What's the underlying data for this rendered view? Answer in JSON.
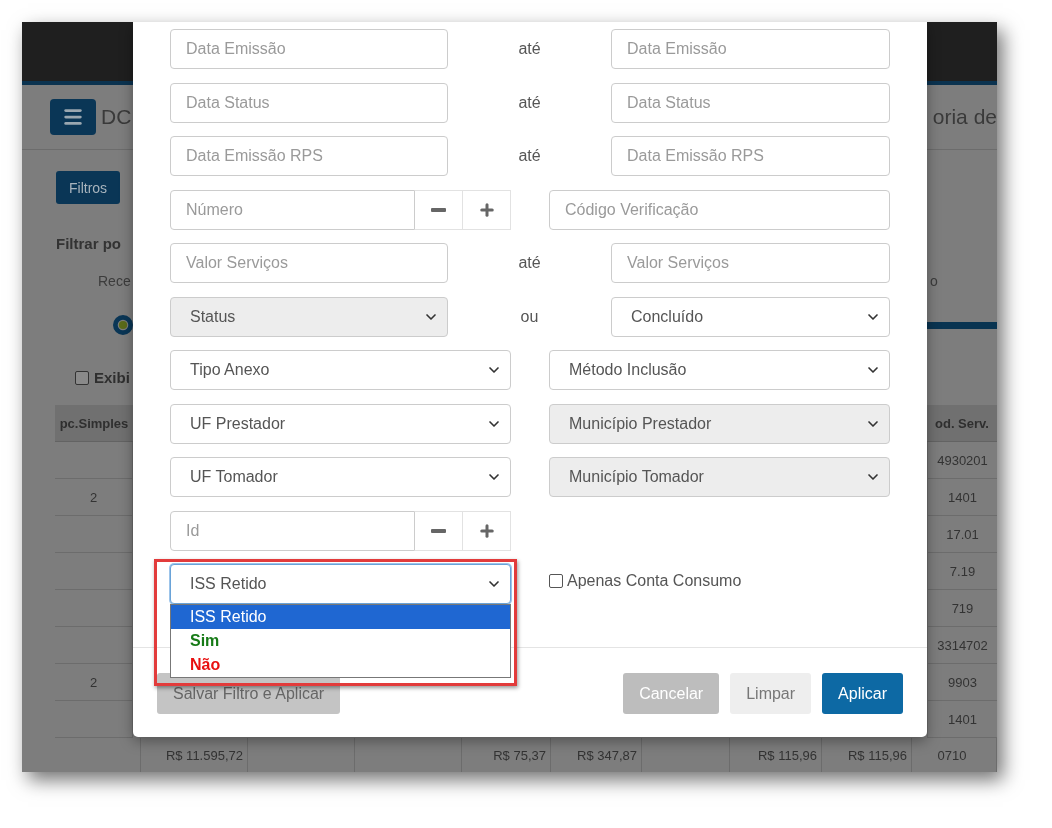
{
  "background": {
    "title": "DC",
    "title_right": "oria de",
    "filter_button": "Filtros",
    "filter_heading": "Filtrar po",
    "legend_left": "Rece",
    "legend_right": "o",
    "checkbox": {
      "label": "Exibi",
      "checked": false
    },
    "table": {
      "left_header": "pc.Simples",
      "right_header": "od. Serv.",
      "left_cells": [
        {},
        {
          "text": "2"
        },
        {},
        {},
        {},
        {},
        {
          "text": "2"
        },
        {}
      ],
      "right_cells": [
        "4930201",
        "1401",
        "17.01",
        "7.19",
        "719",
        "3314702",
        "9903",
        "1401"
      ],
      "bottom_row": [
        {
          "kind": "blank"
        },
        {
          "kind": "value",
          "text": "R$ 11.595,72"
        },
        {
          "kind": "blank"
        },
        {
          "kind": "blank"
        },
        {
          "kind": "value",
          "text": "R$ 75,37"
        },
        {
          "kind": "value",
          "text": "R$ 347,87"
        },
        {
          "kind": "blank"
        },
        {
          "kind": "value",
          "text": "R$ 115,96"
        },
        {
          "kind": "value",
          "text": "R$ 115,96"
        },
        {
          "kind": "value",
          "text": "0710"
        }
      ]
    }
  },
  "modal": {
    "rows": [
      {
        "kind": "range",
        "left": {
          "kind": "input",
          "placeholder": "Data Emissão"
        },
        "separator": "até",
        "right": {
          "kind": "input",
          "placeholder": "Data Emissão"
        }
      },
      {
        "kind": "range",
        "left": {
          "kind": "input",
          "placeholder": "Data Status"
        },
        "separator": "até",
        "right": {
          "kind": "input",
          "placeholder": "Data Status"
        }
      },
      {
        "kind": "range",
        "left": {
          "kind": "input",
          "placeholder": "Data Emissão RPS"
        },
        "separator": "até",
        "right": {
          "kind": "input",
          "placeholder": "Data Emissão RPS"
        }
      },
      {
        "kind": "pair",
        "left": {
          "kind": "stepper",
          "placeholder": "Número"
        },
        "right": {
          "kind": "input",
          "placeholder": "Código Verificação"
        }
      },
      {
        "kind": "range",
        "left": {
          "kind": "input",
          "placeholder": "Valor Serviços"
        },
        "separator": "até",
        "right": {
          "kind": "input",
          "placeholder": "Valor Serviços"
        }
      },
      {
        "kind": "range",
        "left": {
          "kind": "select",
          "value": "Status",
          "disabled": true
        },
        "separator": "ou",
        "right": {
          "kind": "select",
          "value": "Concluído",
          "disabled": false
        }
      },
      {
        "kind": "pair",
        "left": {
          "kind": "select",
          "value": "Tipo Anexo",
          "disabled": false
        },
        "right": {
          "kind": "select",
          "value": "Método Inclusão",
          "disabled": false
        }
      },
      {
        "kind": "pair",
        "left": {
          "kind": "select",
          "value": "UF Prestador",
          "disabled": false
        },
        "right": {
          "kind": "select",
          "value": "Município Prestador",
          "disabled": true
        }
      },
      {
        "kind": "pair",
        "left": {
          "kind": "select",
          "value": "UF Tomador",
          "disabled": false
        },
        "right": {
          "kind": "select",
          "value": "Município Tomador",
          "disabled": true
        }
      },
      {
        "kind": "pair",
        "left": {
          "kind": "stepper",
          "placeholder": "Id"
        }
      },
      {
        "kind": "pair",
        "left": {
          "kind": "select",
          "value": "ISS Retido",
          "disabled": false,
          "open": true,
          "highlighted": true,
          "options": [
            {
              "label": "ISS Retido",
              "selected": true
            },
            {
              "label": "Sim",
              "selected": false,
              "color": "#167a16"
            },
            {
              "label": "Não",
              "selected": false,
              "color": "#e81010"
            }
          ]
        },
        "right": {
          "kind": "checkbox",
          "label": "Apenas Conta Consumo",
          "checked": false
        }
      }
    ],
    "buttons": [
      {
        "kind": "save",
        "label": "Salvar Filtro e Aplicar",
        "disabled": true
      },
      {
        "kind": "cancel",
        "label": "Cancelar"
      },
      {
        "kind": "clear",
        "label": "Limpar"
      },
      {
        "kind": "apply",
        "label": "Aplicar"
      }
    ]
  }
}
